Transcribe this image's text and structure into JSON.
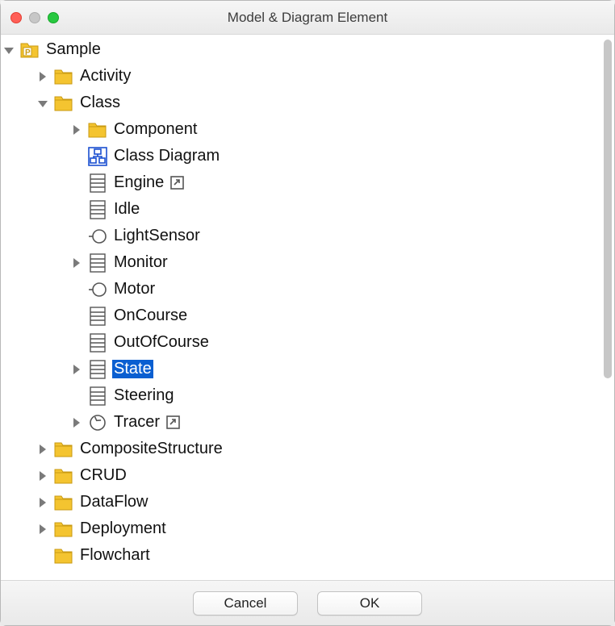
{
  "window": {
    "title": "Model & Diagram Element"
  },
  "tree": [
    {
      "depth": 0,
      "arrow": "down",
      "icon": "project",
      "label": "Sample"
    },
    {
      "depth": 1,
      "arrow": "right",
      "icon": "folder",
      "label": "Activity"
    },
    {
      "depth": 1,
      "arrow": "down",
      "icon": "folder",
      "label": "Class"
    },
    {
      "depth": 2,
      "arrow": "right",
      "icon": "folder",
      "label": "Component"
    },
    {
      "depth": 2,
      "arrow": "none",
      "icon": "diagram",
      "label": "Class Diagram"
    },
    {
      "depth": 2,
      "arrow": "none",
      "icon": "class",
      "label": "Engine",
      "link": true
    },
    {
      "depth": 2,
      "arrow": "none",
      "icon": "class",
      "label": "Idle"
    },
    {
      "depth": 2,
      "arrow": "none",
      "icon": "interface",
      "label": "LightSensor"
    },
    {
      "depth": 2,
      "arrow": "right",
      "icon": "class",
      "label": "Monitor"
    },
    {
      "depth": 2,
      "arrow": "none",
      "icon": "interface",
      "label": "Motor"
    },
    {
      "depth": 2,
      "arrow": "none",
      "icon": "class",
      "label": "OnCourse"
    },
    {
      "depth": 2,
      "arrow": "none",
      "icon": "class",
      "label": "OutOfCourse"
    },
    {
      "depth": 2,
      "arrow": "right",
      "icon": "class",
      "label": "State",
      "selected": true
    },
    {
      "depth": 2,
      "arrow": "none",
      "icon": "class",
      "label": "Steering"
    },
    {
      "depth": 2,
      "arrow": "right",
      "icon": "activeclass",
      "label": "Tracer",
      "link": true
    },
    {
      "depth": 1,
      "arrow": "right",
      "icon": "folder",
      "label": "CompositeStructure"
    },
    {
      "depth": 1,
      "arrow": "right",
      "icon": "folder",
      "label": "CRUD"
    },
    {
      "depth": 1,
      "arrow": "right",
      "icon": "folder",
      "label": "DataFlow"
    },
    {
      "depth": 1,
      "arrow": "right",
      "icon": "folder",
      "label": "Deployment"
    },
    {
      "depth": 1,
      "arrow": "none",
      "icon": "folder",
      "label": "Flowchart"
    }
  ],
  "buttons": {
    "cancel": "Cancel",
    "ok": "OK"
  }
}
